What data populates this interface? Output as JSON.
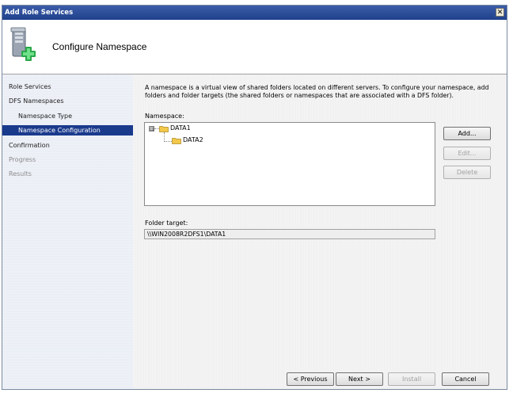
{
  "window": {
    "title": "Add Role Services",
    "close_glyph": "✕"
  },
  "banner": {
    "title": "Configure Namespace",
    "icon": "server-add-icon"
  },
  "nav": {
    "items": [
      {
        "label": "Role Services",
        "state": "normal"
      },
      {
        "label": "DFS Namespaces",
        "state": "normal"
      },
      {
        "label": "Namespace Type",
        "state": "normal"
      },
      {
        "label": "Namespace Configuration",
        "state": "active"
      },
      {
        "label": "Confirmation",
        "state": "normal"
      },
      {
        "label": "Progress",
        "state": "disabled"
      },
      {
        "label": "Results",
        "state": "disabled"
      }
    ]
  },
  "content": {
    "description": "A namespace is a virtual view of shared folders located on different servers. To configure your namespace, add folders and folder targets (the shared folders or namespaces that are associated with a DFS folder).",
    "namespace_label": "Namespace:",
    "tree": {
      "root": {
        "label": "DATA1",
        "expander": "⊟"
      },
      "child": {
        "label": "DATA2"
      }
    },
    "buttons": {
      "add": "Add...",
      "edit": "Edit...",
      "delete": "Delete"
    },
    "folder_target_label": "Folder target:",
    "folder_target_value": "\\\\WIN2008R2DFS1\\DATA1"
  },
  "footer": {
    "previous": "< Previous",
    "next": "Next >",
    "install": "Install",
    "cancel": "Cancel"
  },
  "colors": {
    "titlebar": "#20408c",
    "nav_active": "#1a3a8c",
    "folder": "#f2c84b"
  }
}
